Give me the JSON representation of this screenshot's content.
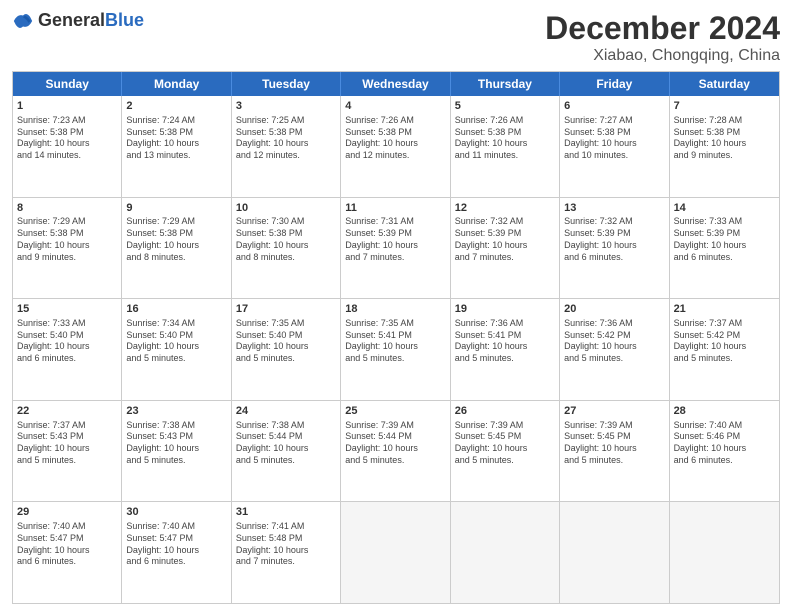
{
  "header": {
    "logo_general": "General",
    "logo_blue": "Blue",
    "title": "December 2024",
    "subtitle": "Xiabao, Chongqing, China"
  },
  "days_of_week": [
    "Sunday",
    "Monday",
    "Tuesday",
    "Wednesday",
    "Thursday",
    "Friday",
    "Saturday"
  ],
  "weeks": [
    [
      {
        "day": "1",
        "lines": [
          "Sunrise: 7:23 AM",
          "Sunset: 5:38 PM",
          "Daylight: 10 hours",
          "and 14 minutes."
        ]
      },
      {
        "day": "2",
        "lines": [
          "Sunrise: 7:24 AM",
          "Sunset: 5:38 PM",
          "Daylight: 10 hours",
          "and 13 minutes."
        ]
      },
      {
        "day": "3",
        "lines": [
          "Sunrise: 7:25 AM",
          "Sunset: 5:38 PM",
          "Daylight: 10 hours",
          "and 12 minutes."
        ]
      },
      {
        "day": "4",
        "lines": [
          "Sunrise: 7:26 AM",
          "Sunset: 5:38 PM",
          "Daylight: 10 hours",
          "and 12 minutes."
        ]
      },
      {
        "day": "5",
        "lines": [
          "Sunrise: 7:26 AM",
          "Sunset: 5:38 PM",
          "Daylight: 10 hours",
          "and 11 minutes."
        ]
      },
      {
        "day": "6",
        "lines": [
          "Sunrise: 7:27 AM",
          "Sunset: 5:38 PM",
          "Daylight: 10 hours",
          "and 10 minutes."
        ]
      },
      {
        "day": "7",
        "lines": [
          "Sunrise: 7:28 AM",
          "Sunset: 5:38 PM",
          "Daylight: 10 hours",
          "and 9 minutes."
        ]
      }
    ],
    [
      {
        "day": "8",
        "lines": [
          "Sunrise: 7:29 AM",
          "Sunset: 5:38 PM",
          "Daylight: 10 hours",
          "and 9 minutes."
        ]
      },
      {
        "day": "9",
        "lines": [
          "Sunrise: 7:29 AM",
          "Sunset: 5:38 PM",
          "Daylight: 10 hours",
          "and 8 minutes."
        ]
      },
      {
        "day": "10",
        "lines": [
          "Sunrise: 7:30 AM",
          "Sunset: 5:38 PM",
          "Daylight: 10 hours",
          "and 8 minutes."
        ]
      },
      {
        "day": "11",
        "lines": [
          "Sunrise: 7:31 AM",
          "Sunset: 5:39 PM",
          "Daylight: 10 hours",
          "and 7 minutes."
        ]
      },
      {
        "day": "12",
        "lines": [
          "Sunrise: 7:32 AM",
          "Sunset: 5:39 PM",
          "Daylight: 10 hours",
          "and 7 minutes."
        ]
      },
      {
        "day": "13",
        "lines": [
          "Sunrise: 7:32 AM",
          "Sunset: 5:39 PM",
          "Daylight: 10 hours",
          "and 6 minutes."
        ]
      },
      {
        "day": "14",
        "lines": [
          "Sunrise: 7:33 AM",
          "Sunset: 5:39 PM",
          "Daylight: 10 hours",
          "and 6 minutes."
        ]
      }
    ],
    [
      {
        "day": "15",
        "lines": [
          "Sunrise: 7:33 AM",
          "Sunset: 5:40 PM",
          "Daylight: 10 hours",
          "and 6 minutes."
        ]
      },
      {
        "day": "16",
        "lines": [
          "Sunrise: 7:34 AM",
          "Sunset: 5:40 PM",
          "Daylight: 10 hours",
          "and 5 minutes."
        ]
      },
      {
        "day": "17",
        "lines": [
          "Sunrise: 7:35 AM",
          "Sunset: 5:40 PM",
          "Daylight: 10 hours",
          "and 5 minutes."
        ]
      },
      {
        "day": "18",
        "lines": [
          "Sunrise: 7:35 AM",
          "Sunset: 5:41 PM",
          "Daylight: 10 hours",
          "and 5 minutes."
        ]
      },
      {
        "day": "19",
        "lines": [
          "Sunrise: 7:36 AM",
          "Sunset: 5:41 PM",
          "Daylight: 10 hours",
          "and 5 minutes."
        ]
      },
      {
        "day": "20",
        "lines": [
          "Sunrise: 7:36 AM",
          "Sunset: 5:42 PM",
          "Daylight: 10 hours",
          "and 5 minutes."
        ]
      },
      {
        "day": "21",
        "lines": [
          "Sunrise: 7:37 AM",
          "Sunset: 5:42 PM",
          "Daylight: 10 hours",
          "and 5 minutes."
        ]
      }
    ],
    [
      {
        "day": "22",
        "lines": [
          "Sunrise: 7:37 AM",
          "Sunset: 5:43 PM",
          "Daylight: 10 hours",
          "and 5 minutes."
        ]
      },
      {
        "day": "23",
        "lines": [
          "Sunrise: 7:38 AM",
          "Sunset: 5:43 PM",
          "Daylight: 10 hours",
          "and 5 minutes."
        ]
      },
      {
        "day": "24",
        "lines": [
          "Sunrise: 7:38 AM",
          "Sunset: 5:44 PM",
          "Daylight: 10 hours",
          "and 5 minutes."
        ]
      },
      {
        "day": "25",
        "lines": [
          "Sunrise: 7:39 AM",
          "Sunset: 5:44 PM",
          "Daylight: 10 hours",
          "and 5 minutes."
        ]
      },
      {
        "day": "26",
        "lines": [
          "Sunrise: 7:39 AM",
          "Sunset: 5:45 PM",
          "Daylight: 10 hours",
          "and 5 minutes."
        ]
      },
      {
        "day": "27",
        "lines": [
          "Sunrise: 7:39 AM",
          "Sunset: 5:45 PM",
          "Daylight: 10 hours",
          "and 5 minutes."
        ]
      },
      {
        "day": "28",
        "lines": [
          "Sunrise: 7:40 AM",
          "Sunset: 5:46 PM",
          "Daylight: 10 hours",
          "and 6 minutes."
        ]
      }
    ],
    [
      {
        "day": "29",
        "lines": [
          "Sunrise: 7:40 AM",
          "Sunset: 5:47 PM",
          "Daylight: 10 hours",
          "and 6 minutes."
        ]
      },
      {
        "day": "30",
        "lines": [
          "Sunrise: 7:40 AM",
          "Sunset: 5:47 PM",
          "Daylight: 10 hours",
          "and 6 minutes."
        ]
      },
      {
        "day": "31",
        "lines": [
          "Sunrise: 7:41 AM",
          "Sunset: 5:48 PM",
          "Daylight: 10 hours",
          "and 7 minutes."
        ]
      },
      {
        "day": "",
        "lines": []
      },
      {
        "day": "",
        "lines": []
      },
      {
        "day": "",
        "lines": []
      },
      {
        "day": "",
        "lines": []
      }
    ]
  ]
}
